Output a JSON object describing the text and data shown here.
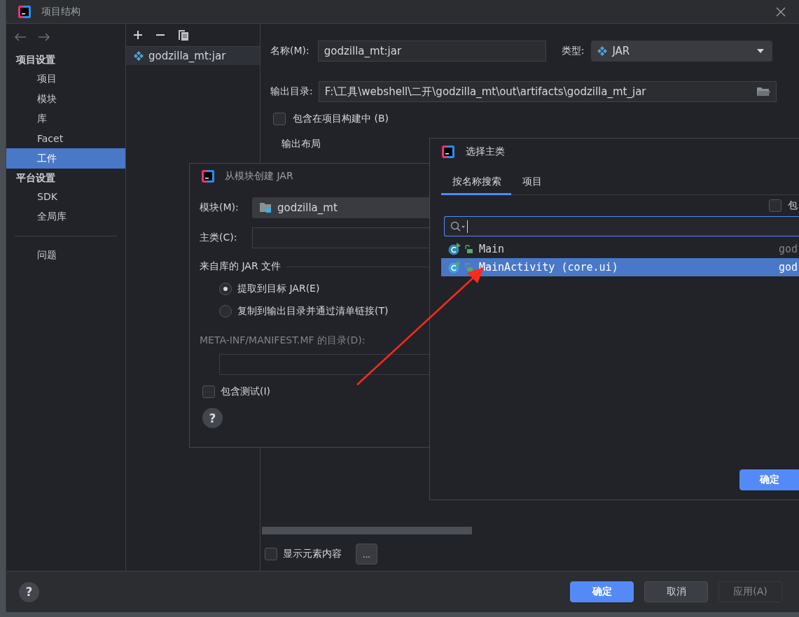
{
  "window": {
    "title": "项目结构"
  },
  "sidebar": {
    "sections": [
      {
        "heading": "项目设置",
        "items": [
          {
            "label": "项目",
            "selected": false
          },
          {
            "label": "模块",
            "selected": false
          },
          {
            "label": "库",
            "selected": false
          },
          {
            "label": "Facet",
            "selected": false
          },
          {
            "label": "工件",
            "selected": true
          }
        ]
      },
      {
        "heading": "平台设置",
        "items": [
          {
            "label": "SDK",
            "selected": false
          },
          {
            "label": "全局库",
            "selected": false
          }
        ]
      }
    ],
    "bottom_items": [
      {
        "label": "问题",
        "selected": false
      }
    ]
  },
  "artifacts": [
    {
      "label": "godzilla_mt:jar",
      "selected": true
    }
  ],
  "form": {
    "name_label": "名称(M):",
    "name_value": "godzilla_mt:jar",
    "type_label": "类型:",
    "type_value": "JAR",
    "output_label": "输出目录:",
    "output_value": "F:\\工具\\webshell\\二开\\godzilla_mt\\out\\artifacts\\godzilla_mt_jar",
    "include_build": {
      "label": "包含在项目构建中 (B)",
      "checked": false
    },
    "layout_label": "输出布局",
    "show_contents": {
      "label": "显示元素内容",
      "checked": false
    },
    "more_button": "..."
  },
  "help_button": "?",
  "buttons": [
    {
      "label": "确定",
      "kind": "primary"
    },
    {
      "label": "取消",
      "kind": "normal"
    },
    {
      "label": "应用(A)",
      "kind": "disabled"
    }
  ],
  "create_jar_dialog": {
    "title": "从模块创建 JAR",
    "module_label": "模块(M):",
    "module_value": "godzilla_mt",
    "main_class_label": "主类(C):",
    "library_group": "来自库的 JAR 文件",
    "options": [
      {
        "label": "提取到目标 JAR(E)",
        "selected": true
      },
      {
        "label": "复制到输出目录并通过清单链接(T)",
        "selected": false
      }
    ],
    "manifest_label": "META-INF/MANIFEST.MF 的目录(D):",
    "include_tests": {
      "label": "包含测试(I)",
      "checked": false
    },
    "help_button": "?"
  },
  "choose_main_class_dialog": {
    "title": "选择主类",
    "tabs": [
      {
        "label": "按名称搜索",
        "selected": true
      },
      {
        "label": "项目",
        "selected": false
      }
    ],
    "include_checkbox": {
      "label": "包",
      "checked": false
    },
    "results": [
      {
        "name": "Main",
        "module": "god",
        "selected": false
      },
      {
        "name": "MainActivity (core.ui)",
        "module": "god",
        "selected": true
      }
    ],
    "ok_button": "确定"
  }
}
